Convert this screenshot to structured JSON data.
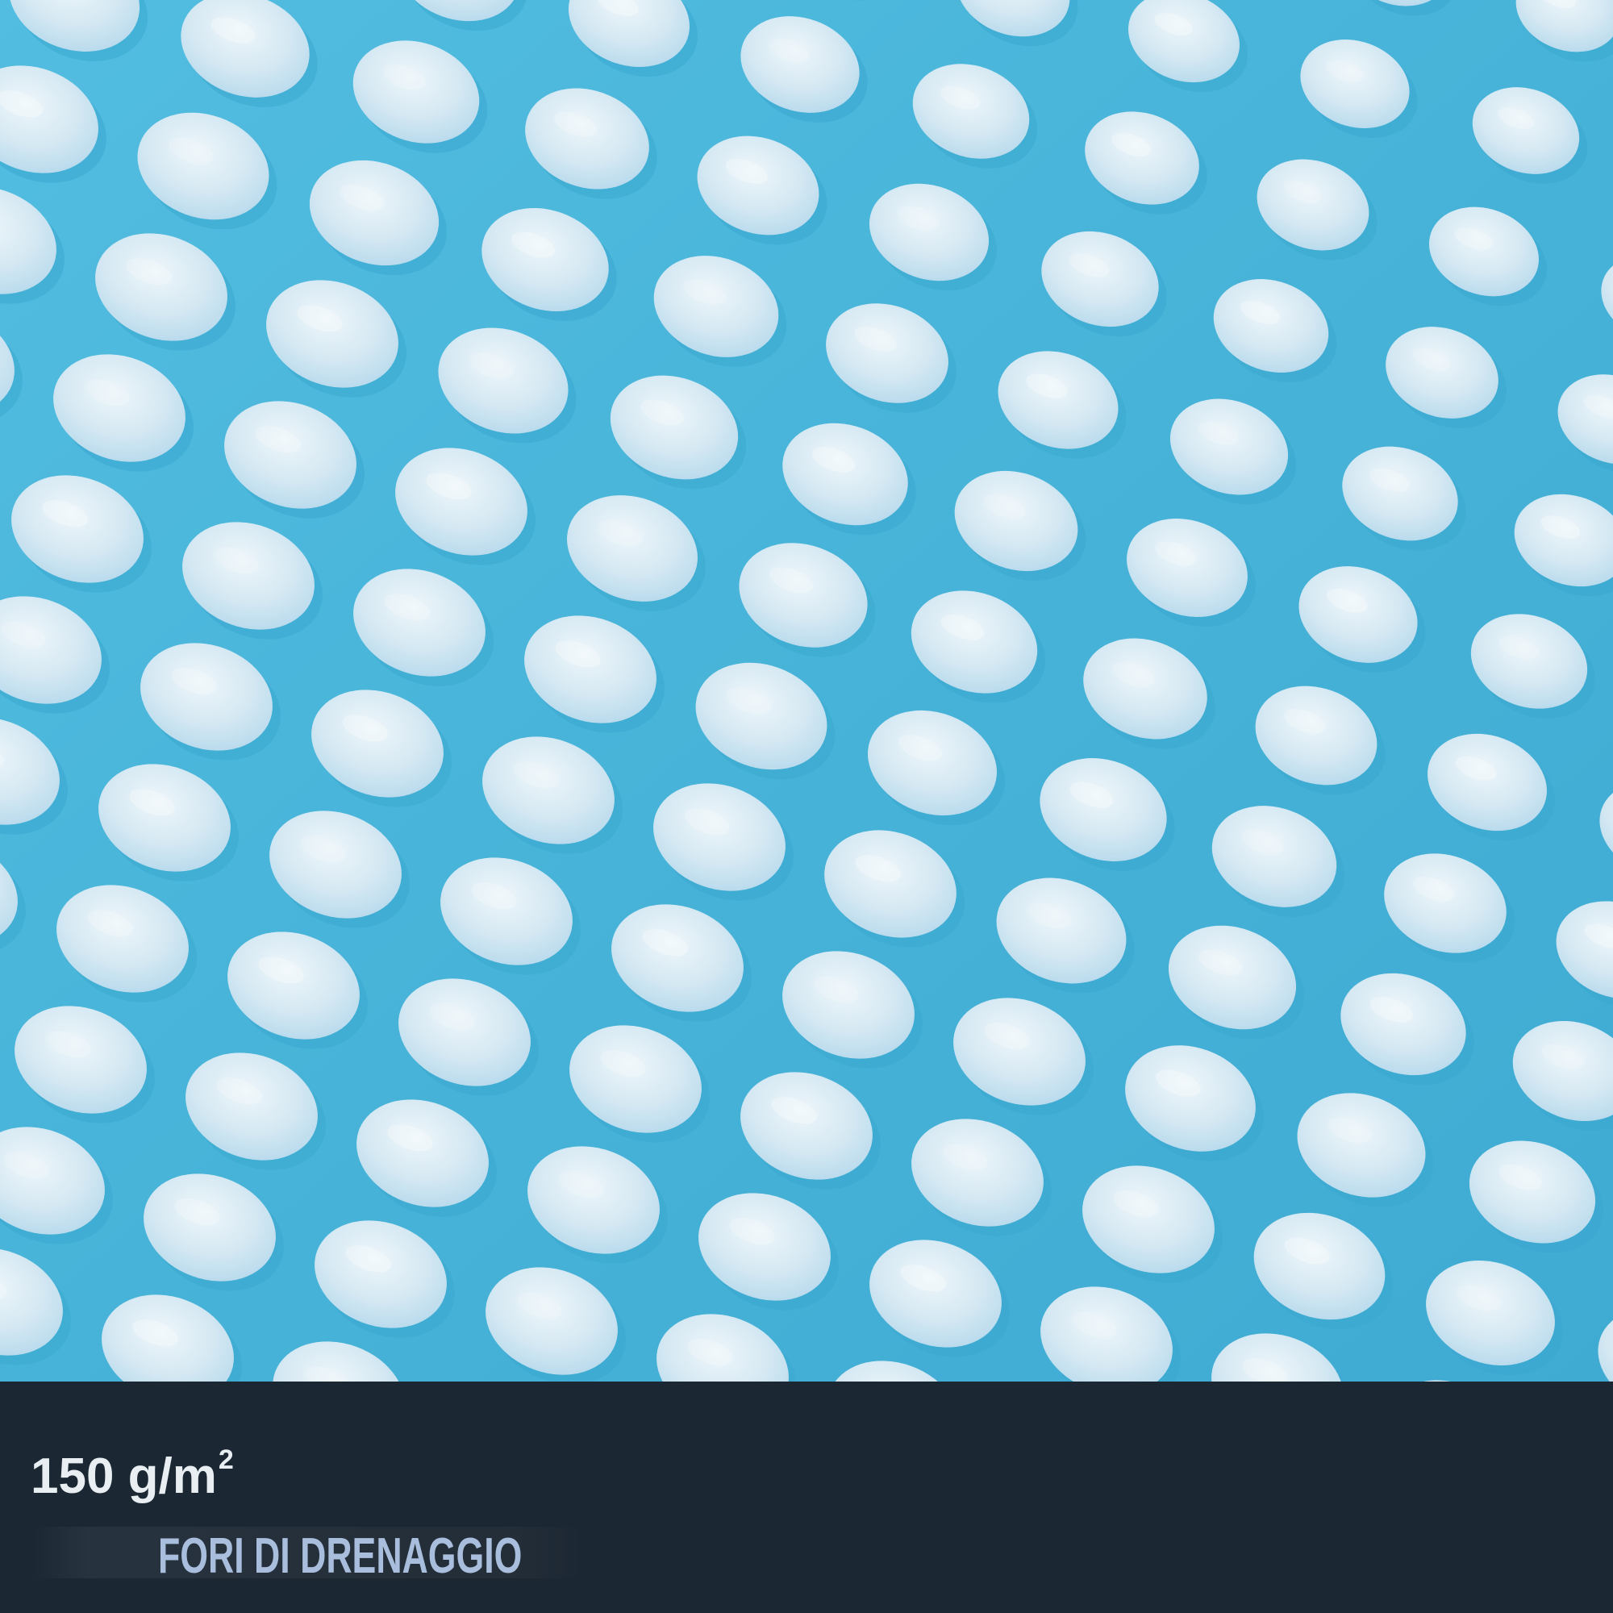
{
  "photo": {
    "subject": "bubble-texture",
    "colors": {
      "background": "#49b6d9",
      "bubble_light": "#dcebf3",
      "bubble_mid": "#b9dcee",
      "bubble_shadow": "#3aa7cf"
    }
  },
  "caption": {
    "weight_value": "150 g/m",
    "weight_exponent": "2",
    "drainage_label": "FORI DI DRENAGGIO",
    "colors": {
      "bar": "#1b2733",
      "weight_text": "#e8eef2",
      "drainage_text": "#a9bedc"
    }
  }
}
